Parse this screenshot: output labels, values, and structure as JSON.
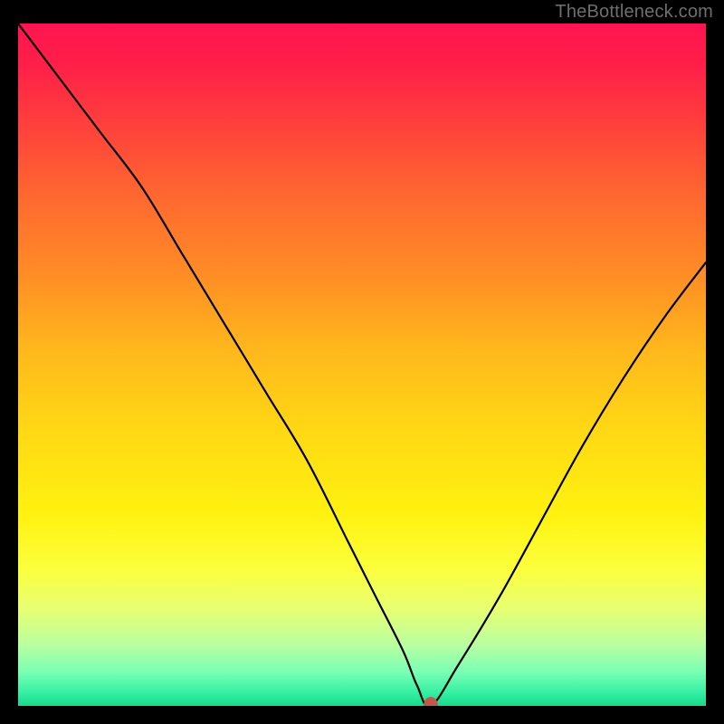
{
  "watermark": "TheBottleneck.com",
  "chart_data": {
    "type": "line",
    "title": "",
    "xlabel": "",
    "ylabel": "",
    "xlim": [
      0,
      100
    ],
    "ylim": [
      0,
      100
    ],
    "grid": false,
    "legend": false,
    "background": "rainbow-vertical-gradient",
    "series": [
      {
        "name": "bottleneck-curve",
        "color": "#000000",
        "x": [
          0,
          6,
          12,
          18,
          24,
          30,
          36,
          42,
          48,
          52,
          56,
          58,
          60,
          64,
          70,
          76,
          82,
          88,
          94,
          100
        ],
        "y": [
          100,
          92,
          84,
          76,
          66,
          56,
          46,
          36,
          24,
          16,
          8,
          3,
          0,
          6,
          16,
          27,
          38,
          48,
          57,
          65
        ]
      }
    ],
    "marker": {
      "x": 60,
      "y": 0,
      "color": "#c4584f"
    }
  }
}
